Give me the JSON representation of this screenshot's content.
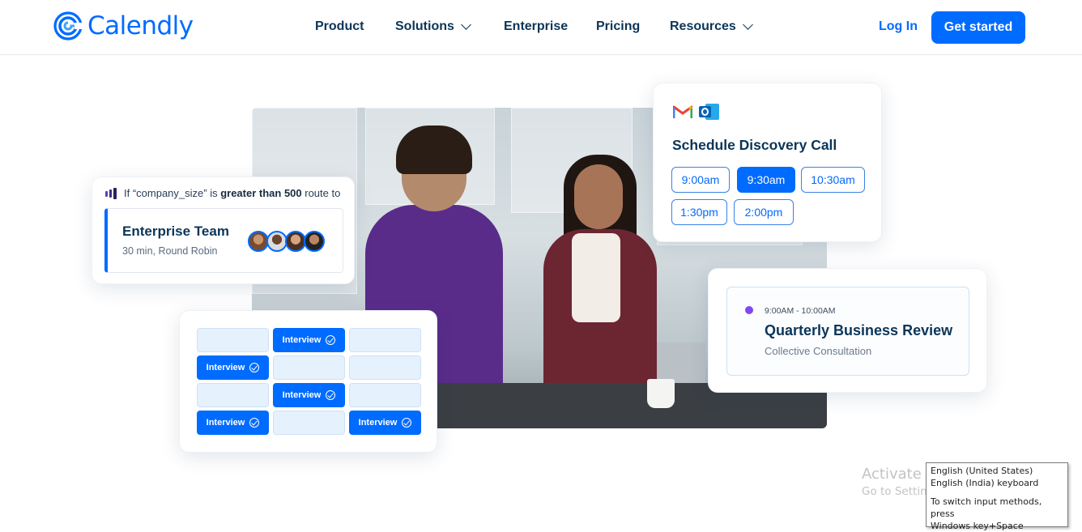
{
  "nav": {
    "brand": "Calendly",
    "items": [
      {
        "label": "Product",
        "has_dropdown": false
      },
      {
        "label": "Solutions",
        "has_dropdown": true
      },
      {
        "label": "Enterprise",
        "has_dropdown": false
      },
      {
        "label": "Pricing",
        "has_dropdown": false
      },
      {
        "label": "Resources",
        "has_dropdown": true
      }
    ],
    "login": "Log In",
    "cta": "Get started"
  },
  "colors": {
    "brand_blue": "#006bff",
    "navy_text": "#0b3558",
    "event_purple": "#8247f5"
  },
  "routing_card": {
    "icon": "routing-icon",
    "rule_prefix": "If “company_size” is ",
    "rule_bold": "greater than 500",
    "rule_suffix": " route to",
    "team_name": "Enterprise Team",
    "team_meta": "30 min, Round Robin",
    "avatar_count": 4
  },
  "interview_grid": {
    "label": "Interview",
    "icon": "check-circle-icon",
    "rows": [
      [
        false,
        true,
        false
      ],
      [
        true,
        false,
        false
      ],
      [
        false,
        true,
        false
      ],
      [
        true,
        false,
        true
      ]
    ]
  },
  "schedule_card": {
    "icons": [
      "gmail-icon",
      "outlook-icon"
    ],
    "title": "Schedule Discovery Call",
    "slots": [
      {
        "label": "9:00am",
        "selected": false
      },
      {
        "label": "9:30am",
        "selected": true
      },
      {
        "label": "10:30am",
        "selected": false
      },
      {
        "label": "1:30pm",
        "selected": false
      },
      {
        "label": "2:00pm",
        "selected": false
      }
    ]
  },
  "event_card": {
    "time": "9:00AM - 10:00AM",
    "title": "Quarterly Business Review",
    "subtitle": "Collective Consultation"
  },
  "os_overlay": {
    "watermark_title": "Activate Windows",
    "watermark_sub": "Go to Settings to activate Windows.",
    "ime_lines": [
      "English (United States)",
      "English (India) keyboard",
      "To switch input methods, press",
      "Windows key+Space"
    ]
  }
}
